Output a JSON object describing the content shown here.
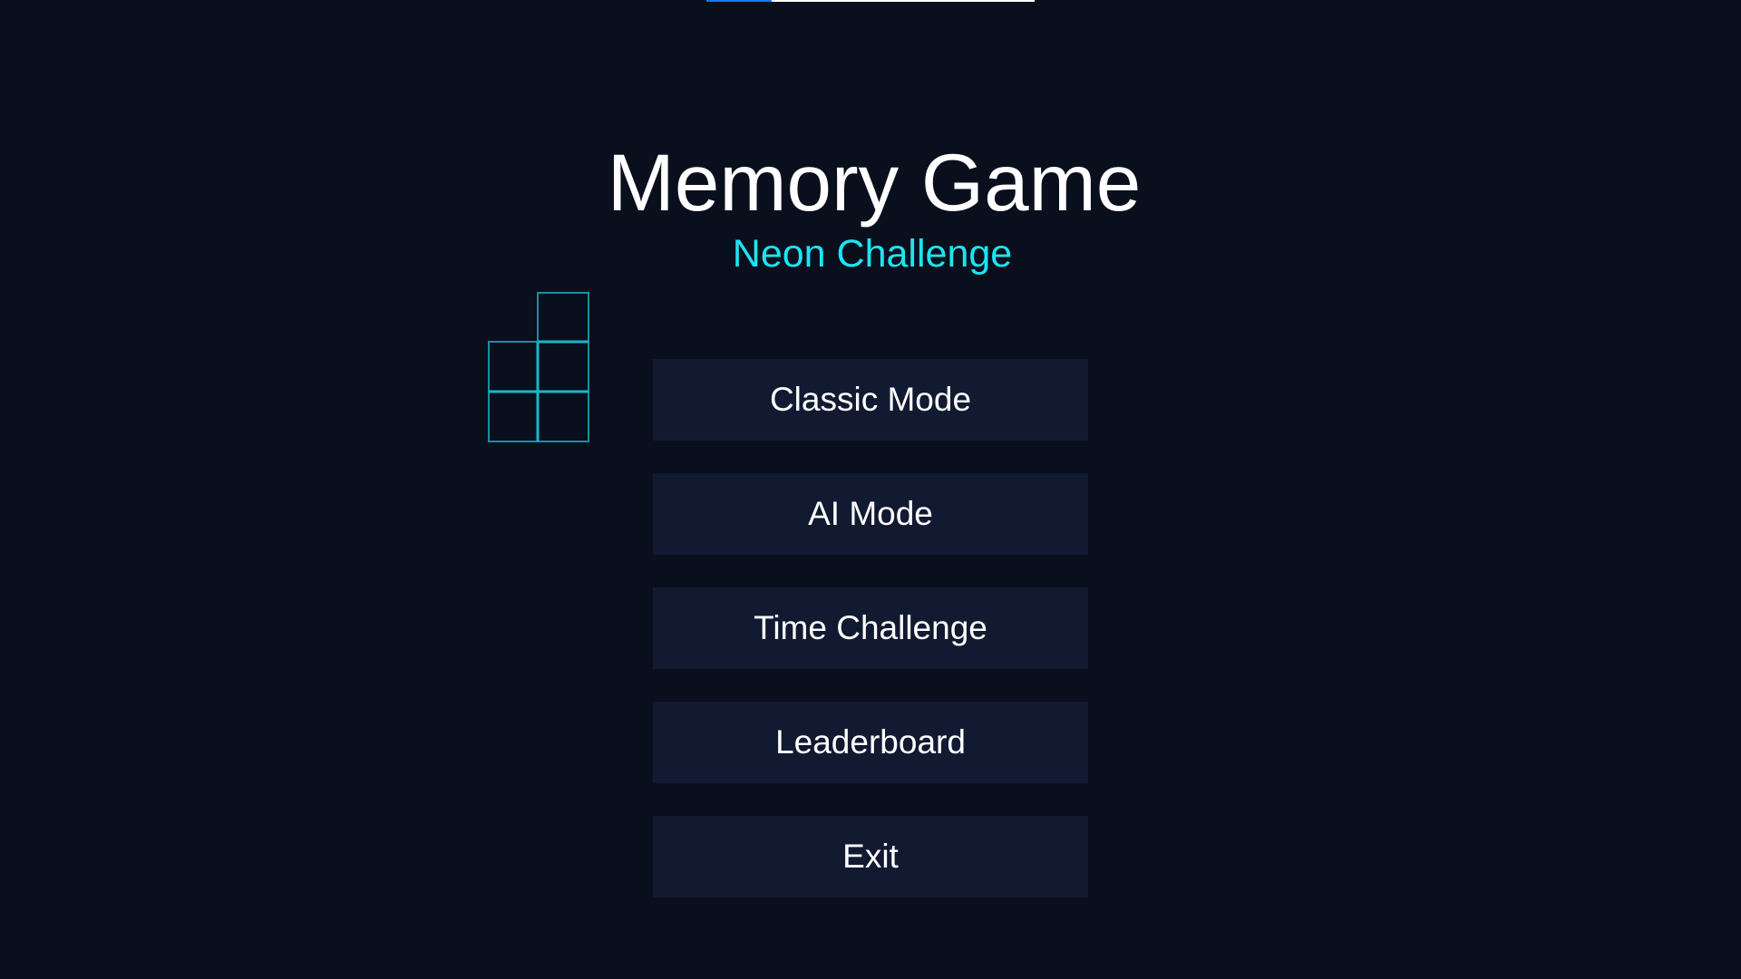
{
  "game": {
    "title": "Memory Game",
    "subtitle": "Neon Challenge"
  },
  "colors": {
    "background": "#0a0f1d",
    "button_background": "#111a31",
    "accent_cyan": "#1de4f0",
    "grid_stroke": "#1a8fa0",
    "top_bar": "#ffffff",
    "top_bar_accent": "#0c7cff"
  },
  "top_bar": {
    "progress": 0.2
  },
  "menu": {
    "buttons": [
      {
        "label": "Classic Mode"
      },
      {
        "label": "AI Mode"
      },
      {
        "label": "Time Challenge"
      },
      {
        "label": "Leaderboard"
      },
      {
        "label": "Exit"
      }
    ]
  }
}
